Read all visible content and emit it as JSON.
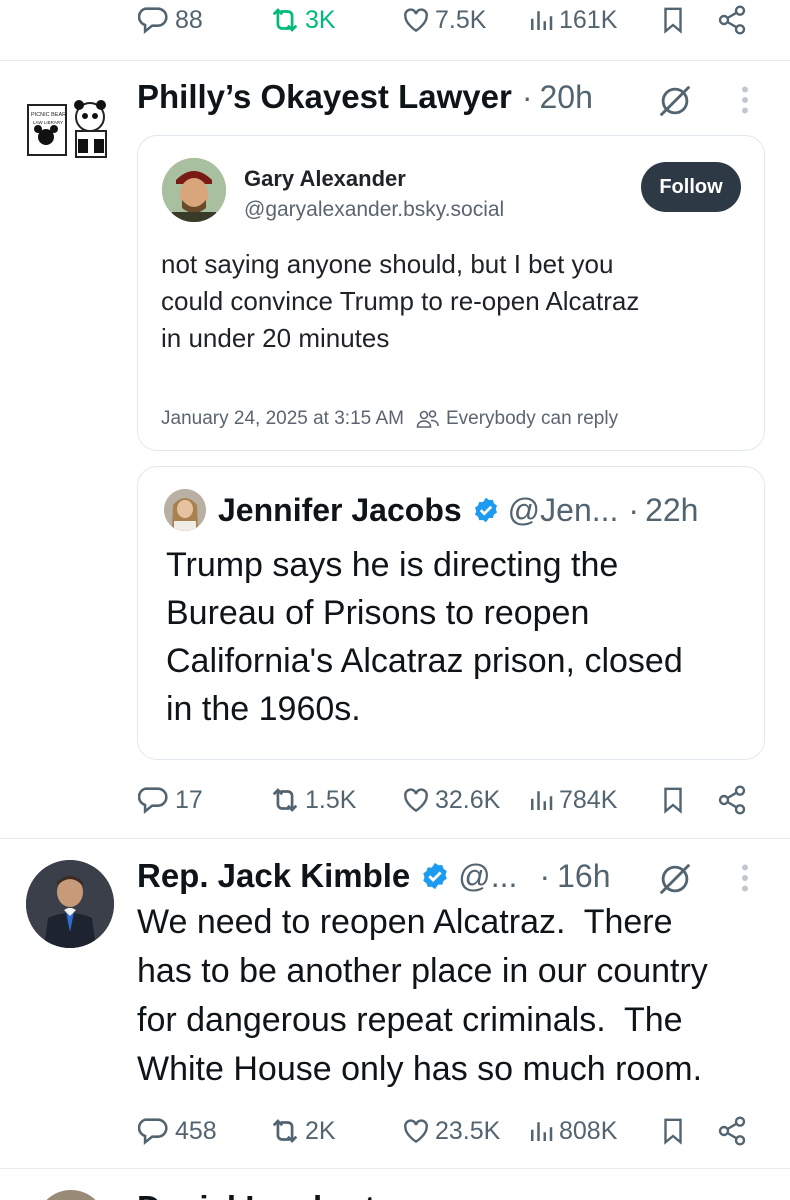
{
  "top_actions": {
    "replies": "88",
    "retweets": "3K",
    "likes": "7.5K",
    "views": "161K"
  },
  "tweet1": {
    "author_name": "Philly’s Okayest Lawyer",
    "separator": "·",
    "time": "20h",
    "avatar_text_1": "PICNIC BEAR",
    "avatar_text_2": "LAW LIBRARY",
    "bluesky_card": {
      "name": "Gary Alexander",
      "handle": "@garyalexander.bsky.social",
      "follow_label": "Follow",
      "text_lines": [
        "not saying anyone should, but I bet you",
        "could convince Trump to re-open Alcatraz",
        "in under 20 minutes"
      ],
      "date": "January 24, 2025 at 3:15 AM",
      "reply_setting": "Everybody can reply"
    },
    "quote": {
      "name": "Jennifer Jacobs",
      "handle": "@Jen...",
      "separator": "·",
      "time": "22h",
      "text_lines": [
        "Trump says he is directing the",
        "Bureau of Prisons to reopen",
        "California's Alcatraz prison, closed",
        "in the 1960s."
      ]
    },
    "actions": {
      "replies": "17",
      "retweets": "1.5K",
      "likes": "32.6K",
      "views": "784K"
    }
  },
  "tweet2": {
    "author_name": "Rep. Jack Kimble",
    "handle": "@...",
    "separator": "·",
    "time": "16h",
    "text_lines": [
      "We need to reopen Alcatraz.  There",
      "has to be another place in our country",
      "for dangerous repeat criminals.  The",
      "White House only has so much room."
    ],
    "actions": {
      "replies": "458",
      "retweets": "2K",
      "likes": "23.5K",
      "views": "808K"
    }
  },
  "tweet3_partial": {
    "author_name": "Daniel Lambert"
  },
  "colors": {
    "verified": "#1d9bf0",
    "retweet_active": "#00ba7c",
    "muted": "#536471",
    "follow_button": "#2d3a45"
  }
}
